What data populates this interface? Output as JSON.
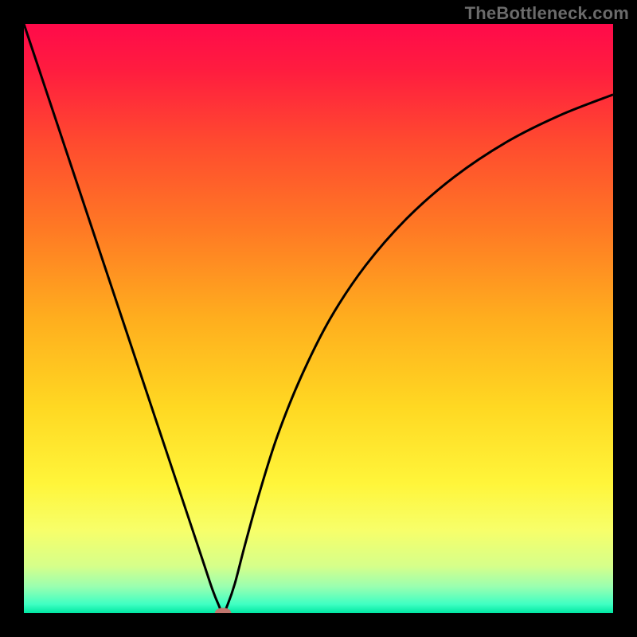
{
  "watermark": "TheBottleneck.com",
  "chart_data": {
    "type": "line",
    "title": "",
    "xlabel": "",
    "ylabel": "",
    "x_range": [
      0,
      1
    ],
    "y_range": [
      0,
      1
    ],
    "axes_visible": false,
    "grid": false,
    "background": {
      "type": "vertical-gradient",
      "stops": [
        {
          "offset": 0.0,
          "color": "#ff0a4a"
        },
        {
          "offset": 0.08,
          "color": "#ff1d3f"
        },
        {
          "offset": 0.2,
          "color": "#ff4a2f"
        },
        {
          "offset": 0.35,
          "color": "#ff7a24"
        },
        {
          "offset": 0.5,
          "color": "#ffae1e"
        },
        {
          "offset": 0.65,
          "color": "#ffd822"
        },
        {
          "offset": 0.78,
          "color": "#fff53a"
        },
        {
          "offset": 0.86,
          "color": "#f7ff6a"
        },
        {
          "offset": 0.92,
          "color": "#d6ff8a"
        },
        {
          "offset": 0.955,
          "color": "#9affb0"
        },
        {
          "offset": 0.985,
          "color": "#3fffc3"
        },
        {
          "offset": 1.0,
          "color": "#00e7a2"
        }
      ]
    },
    "series": [
      {
        "name": "bottleneck-curve",
        "color": "#000000",
        "width": 3,
        "points": [
          {
            "x": 0.0,
            "y": 1.0
          },
          {
            "x": 0.04,
            "y": 0.88
          },
          {
            "x": 0.08,
            "y": 0.76
          },
          {
            "x": 0.12,
            "y": 0.64
          },
          {
            "x": 0.16,
            "y": 0.52
          },
          {
            "x": 0.2,
            "y": 0.4
          },
          {
            "x": 0.23,
            "y": 0.31
          },
          {
            "x": 0.26,
            "y": 0.22
          },
          {
            "x": 0.285,
            "y": 0.145
          },
          {
            "x": 0.305,
            "y": 0.085
          },
          {
            "x": 0.32,
            "y": 0.04
          },
          {
            "x": 0.33,
            "y": 0.015
          },
          {
            "x": 0.338,
            "y": 0.0
          },
          {
            "x": 0.346,
            "y": 0.015
          },
          {
            "x": 0.358,
            "y": 0.05
          },
          {
            "x": 0.375,
            "y": 0.115
          },
          {
            "x": 0.4,
            "y": 0.205
          },
          {
            "x": 0.43,
            "y": 0.3
          },
          {
            "x": 0.47,
            "y": 0.4
          },
          {
            "x": 0.52,
            "y": 0.5
          },
          {
            "x": 0.58,
            "y": 0.59
          },
          {
            "x": 0.65,
            "y": 0.67
          },
          {
            "x": 0.73,
            "y": 0.74
          },
          {
            "x": 0.82,
            "y": 0.8
          },
          {
            "x": 0.91,
            "y": 0.845
          },
          {
            "x": 1.0,
            "y": 0.88
          }
        ]
      }
    ],
    "marker": {
      "x": 0.338,
      "y": 0.0,
      "rx": 0.014,
      "ry": 0.009,
      "color": "#c1766e"
    }
  }
}
